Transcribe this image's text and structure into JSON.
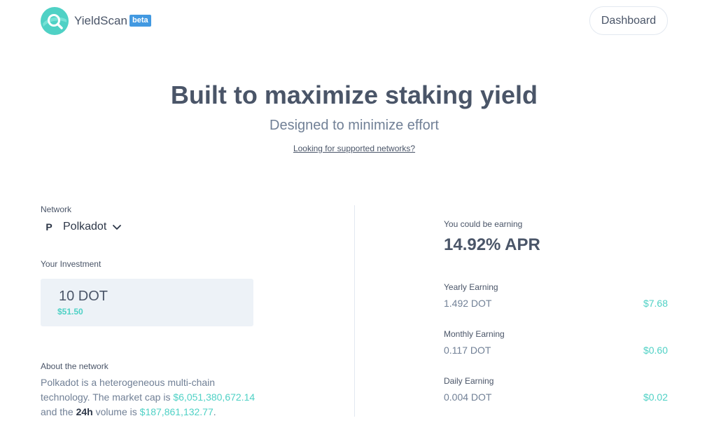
{
  "header": {
    "brand": "YieldScan",
    "badge": "beta",
    "dashboard_button": "Dashboard"
  },
  "hero": {
    "title": "Built to maximize staking yield",
    "subtitle": "Designed to minimize effort",
    "link": "Looking for supported networks?"
  },
  "calculator": {
    "network_label": "Network",
    "network_name": "Polkadot",
    "network_icon": "P",
    "investment_label": "Your Investment",
    "investment_value": "10 DOT",
    "investment_usd": "$51.50",
    "about_label": "About the network",
    "about": {
      "text1": "Polkadot is a heterogeneous multi-chain technology. The market cap is ",
      "market_cap": "$6,051,380,672.14",
      "text2": " and the ",
      "h24": "24h",
      "text3": " volume is ",
      "volume": "$187,861,132.77",
      "text4": "."
    }
  },
  "earnings": {
    "label": "You could be earning",
    "apr": "14.92% APR",
    "rows": [
      {
        "label": "Yearly Earning",
        "dot": "1.492 DOT",
        "usd": "$7.68"
      },
      {
        "label": "Monthly Earning",
        "dot": "0.117 DOT",
        "usd": "$0.60"
      },
      {
        "label": "Daily Earning",
        "dot": "0.004 DOT",
        "usd": "$0.02"
      }
    ]
  },
  "colors": {
    "accent": "#4fd1c5",
    "badge": "#4299e1",
    "text": "#4a5568"
  }
}
